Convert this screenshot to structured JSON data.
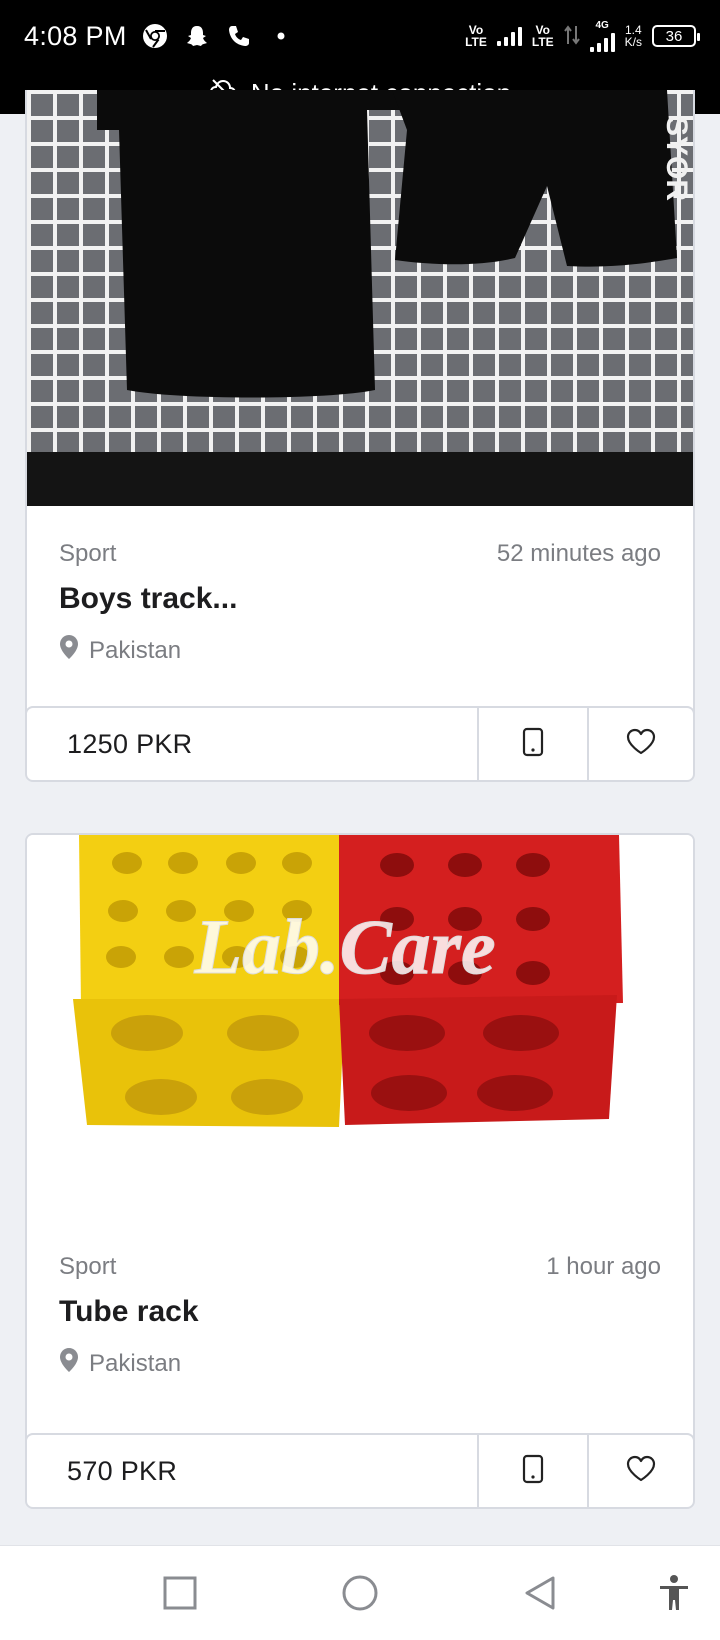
{
  "status_bar": {
    "time": "4:08 PM",
    "left_icons": [
      "chrome-icon",
      "snapchat-icon",
      "phone-call-icon",
      "dot-icon"
    ],
    "sim1_label_top": "Vo",
    "sim1_label_bottom": "LTE",
    "sim2_label_top": "Vo",
    "sim2_label_bottom": "LTE",
    "net_type": "4G",
    "speed_top": "1.4",
    "speed_bottom": "K/s",
    "battery": "36"
  },
  "banner": {
    "text": "No internet connection",
    "icon": "cloud-off-icon"
  },
  "listings": [
    {
      "category": "Sport",
      "time_ago": "52 minutes ago",
      "title": "Boys track...",
      "location": "Pakistan",
      "price": "1250 PKR",
      "image_text": "SYOR"
    },
    {
      "category": "Sport",
      "time_ago": "1 hour ago",
      "title": "Tube rack",
      "location": "Pakistan",
      "price": "570 PKR",
      "watermark": "Lab.Care"
    }
  ],
  "nav": [
    "recents-square-icon",
    "home-circle-icon",
    "back-triangle-icon",
    "accessibility-icon"
  ]
}
